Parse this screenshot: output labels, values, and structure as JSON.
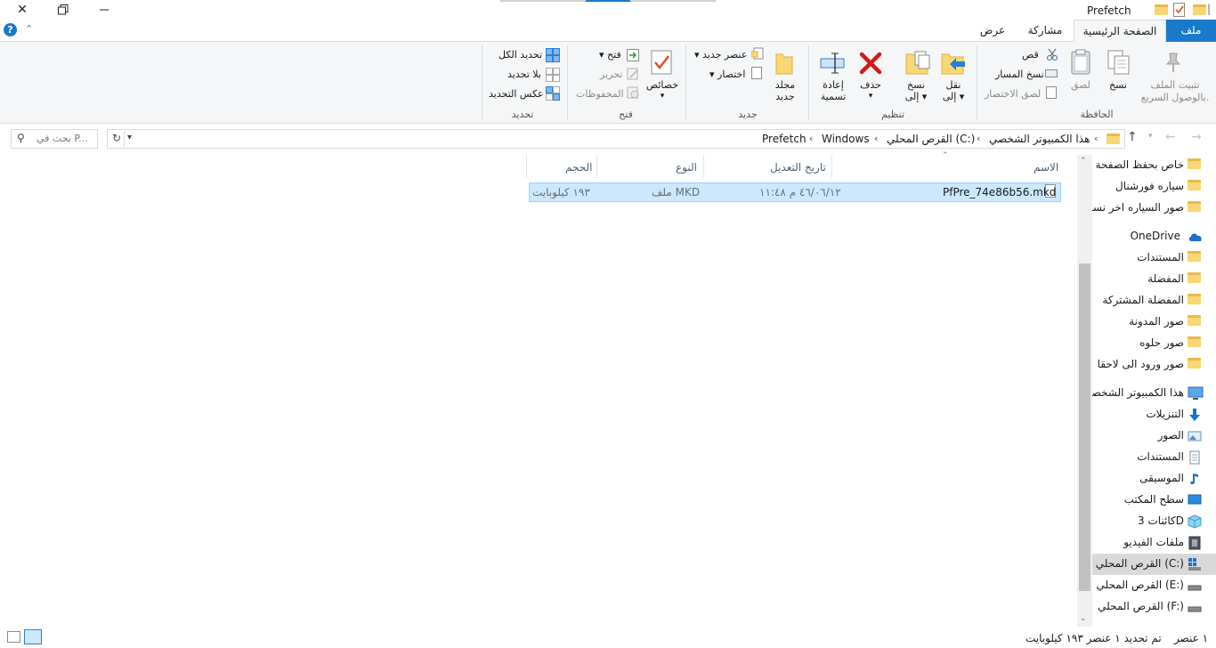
{
  "window": {
    "title": "Prefetch"
  },
  "tabs": {
    "file": "ملف",
    "home": "الصفحة الرئيسية",
    "share": "مشاركة",
    "view": "عرض"
  },
  "ribbon": {
    "clipboard": {
      "group": "الحافظة",
      "pin_line1": "تثبيت الملف",
      "pin_line2": "بالوصول السريع.",
      "copy": "نسخ",
      "paste": "لصق",
      "cut": "قص",
      "copy_path": "نسخ المسار",
      "paste_shortcut": "لصق الاختصار"
    },
    "organize": {
      "group": "تنظيم",
      "move_line1": "نقل",
      "move_line2": "إلى",
      "copyto_line1": "نسخ",
      "copyto_line2": "إلى",
      "delete": "حذف",
      "rename_line1": "إعادة",
      "rename_line2": "تسمية"
    },
    "new": {
      "group": "جديد",
      "folder_line1": "مجلد",
      "folder_line2": "جديد",
      "new_item": "عنصر جديد",
      "easy_access": "اختصار"
    },
    "open": {
      "group": "فتح",
      "properties": "خصائص",
      "open": "فتح",
      "edit": "تحرير",
      "history": "المحفوظات"
    },
    "select": {
      "group": "تحديد",
      "select_all": "تحديد الكل",
      "select_none": "بلا تحديد",
      "invert": "عكس التحديد"
    }
  },
  "address": {
    "crumbs": [
      "هذا الكمبيوتر الشخصي",
      "القرص المحلي (C:)",
      "Windows",
      "Prefetch"
    ],
    "search_placeholder": "بحث في P..."
  },
  "columns": {
    "name": "الاسم",
    "date": "تاريخ التعديل",
    "type": "النوع",
    "size": "الحجم"
  },
  "files": [
    {
      "name": "PfPre_74e86b56.mkd",
      "date": "٤٦/٠٦/١٢ م ١١:٤٨",
      "type": "ملف MKD",
      "size": "١٩٣ كيلوبايت"
    }
  ],
  "nav": {
    "quick": [
      "خاص بحفظ الصفحة",
      "سياره فورشنال",
      "صور السياره اخر نسخة"
    ],
    "onedrive": "OneDrive",
    "onedrive_items": [
      "المستندات",
      "المفضلة",
      "المفضلة المشتركة",
      "صور المدونة",
      "صور حلوه",
      "صور ورود الى لاحقا"
    ],
    "thispc": "هذا الكمبيوتر الشخصي",
    "pc_items": [
      "التنزيلات",
      "الصور",
      "المستندات",
      "الموسيقى",
      "سطح المكتب",
      "كائنات 3D",
      "ملفات الفيديو"
    ],
    "drives": [
      "القرص المحلي (C:)",
      "القرص المحلي (E:)",
      "القرص المحلي (F:)"
    ]
  },
  "status": {
    "count": "١ عنصر",
    "selected": "تم تحديد ١ عنصر ١٩٣ كيلوبايت"
  },
  "colors": {
    "accent": "#1979ca",
    "selection": "#cce8ff",
    "selection_border": "#99d1ff",
    "folder": "#f8d775"
  }
}
